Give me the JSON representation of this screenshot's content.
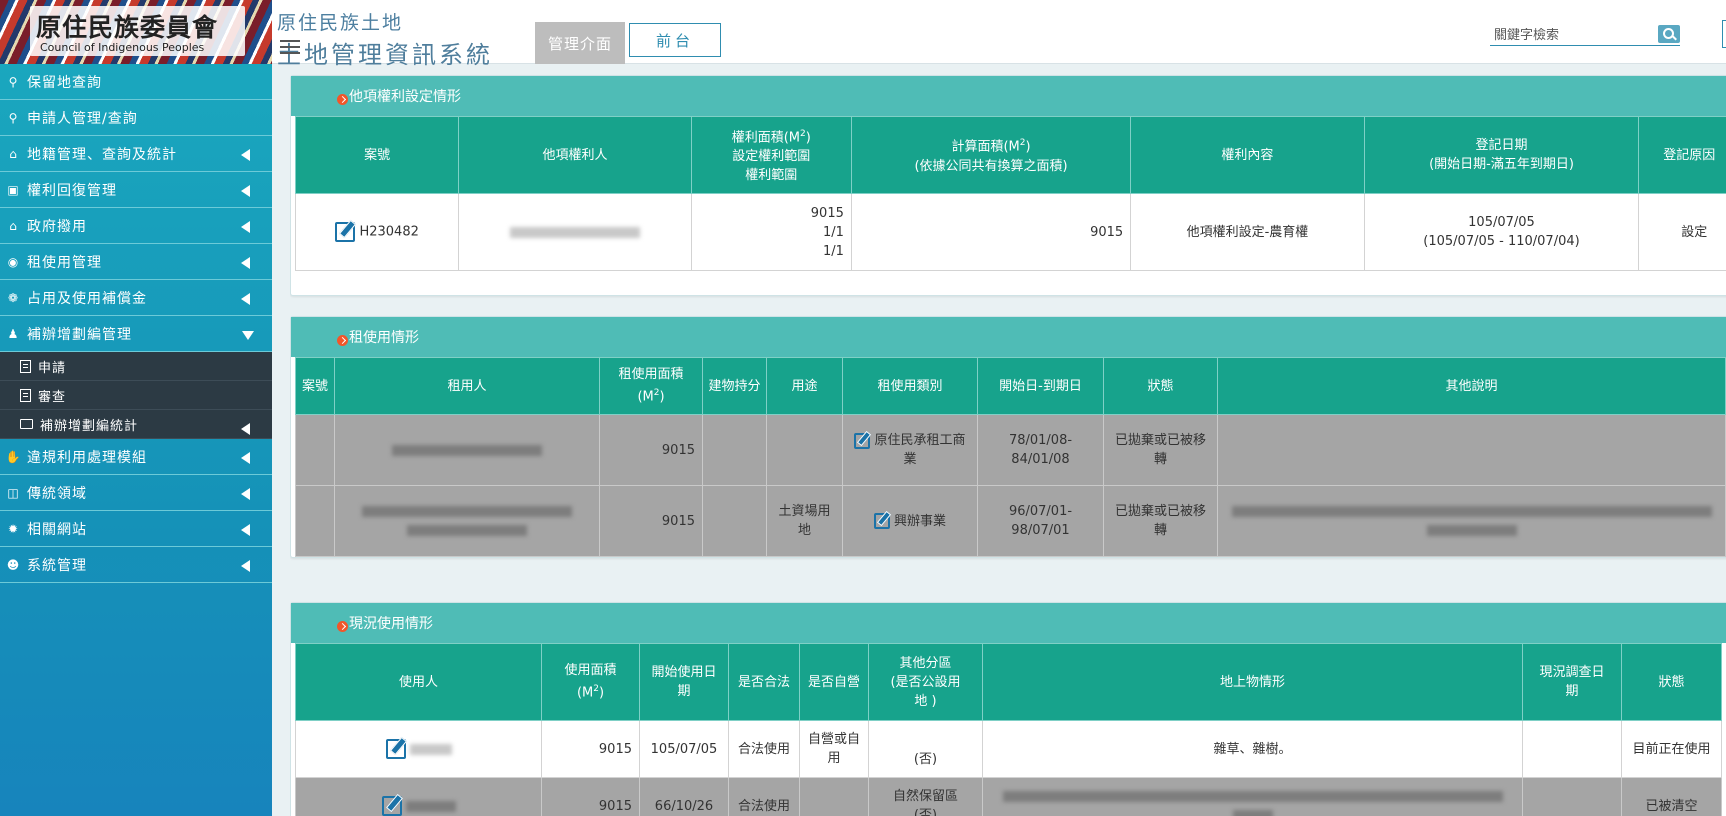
{
  "header": {
    "logo_zh": "原住民族委員會",
    "logo_en": "Council of Indigenous Peoples",
    "system_line1": "原住民族土地",
    "system_line2": "土地管理資訊系統",
    "tab_admin": "管理介面",
    "tab_front": "前台",
    "search_placeholder": "關鍵字檢索"
  },
  "sidebar": {
    "items": [
      {
        "label": "保留地查詢",
        "icon": "search-icon"
      },
      {
        "label": "申請人管理/查詢",
        "icon": "search-icon"
      },
      {
        "label": "地籍管理、查詢及統計",
        "icon": "home-icon"
      },
      {
        "label": "權利回復管理",
        "icon": "briefcase-icon"
      },
      {
        "label": "政府撥用",
        "icon": "home-icon"
      },
      {
        "label": "租使用管理",
        "icon": "cube-icon"
      },
      {
        "label": "占用及使用補償金",
        "icon": "paw-icon"
      },
      {
        "label": "補辦增劃編管理",
        "icon": "person-icon"
      }
    ],
    "sub_items": [
      {
        "label": "申請",
        "icon": "document-icon"
      },
      {
        "label": "審查",
        "icon": "document-icon"
      },
      {
        "label": "補辦增劃編統計",
        "icon": "folder-icon"
      }
    ],
    "items_after": [
      {
        "label": "違規利用處理模組",
        "icon": "hand-icon"
      },
      {
        "label": "傳統領域",
        "icon": "map-icon"
      },
      {
        "label": "相關網站",
        "icon": "gear-icon"
      },
      {
        "label": "系統管理",
        "icon": "user-circle-icon"
      }
    ]
  },
  "rights_panel": {
    "title": "他項權利設定情形",
    "headers": {
      "case_no": "案號",
      "holder": "他項權利人",
      "area_l1": "權利面積(M",
      "area_l2": "設定權利範圍",
      "area_l3": "權利範圍",
      "calc_l1": "計算面積(M",
      "calc_l2": "(依據公同共有換算之面積)",
      "content": "權利內容",
      "date_l1": "登記日期",
      "date_l2": "(開始日期-滿五年到期日)",
      "reason": "登記原因"
    },
    "row": {
      "case_no": "H230482",
      "area": "9015",
      "range1": "1/1",
      "range2": "1/1",
      "calc_area": "9015",
      "content": "他項權利設定-農育權",
      "date": "105/07/05",
      "date_range": "(105/07/05 - 110/07/04)",
      "reason": "設定"
    }
  },
  "lease_panel": {
    "title": "租使用情形",
    "headers": {
      "case_no": "案號",
      "tenant": "租用人",
      "area_l1": "租使用面積",
      "area_l2": "(M",
      "building_share": "建物持分",
      "purpose": "用途",
      "category": "租使用類別",
      "period": "開始日-到期日",
      "status": "狀態",
      "note": "其他說明"
    },
    "rows": [
      {
        "area": "9015",
        "purpose": "",
        "category": "原住民承租工商業",
        "start": "78/01/08-",
        "end": "84/01/08",
        "status": "已拋棄或已被移轉"
      },
      {
        "area": "9015",
        "purpose": "土資場用地",
        "category": "興辦事業",
        "start": "96/07/01-",
        "end": "98/07/01",
        "status": "已拋棄或已被移轉"
      }
    ]
  },
  "usage_panel": {
    "title": "現況使用情形",
    "headers": {
      "user": "使用人",
      "area_l1": "使用面積",
      "area_l2": "(M",
      "start_l1": "開始使用日",
      "start_l2": "期",
      "legal": "是否合法",
      "self_operated": "是否自營",
      "zone_l1": "其他分區",
      "zone_l2": "(是否公設用",
      "zone_l3": "地 )",
      "surface": "地上物情形",
      "survey_l1": "現況調查日",
      "survey_l2": "期",
      "status": "狀態"
    },
    "rows": [
      {
        "area": "9015",
        "start": "105/07/05",
        "legal": "合法使用",
        "self": "自營或自用",
        "zone": "(否)",
        "surface": "雜草、雜樹。",
        "status": "目前正在使用"
      },
      {
        "area": "9015",
        "start": "66/10/26",
        "legal": "合法使用",
        "self": "",
        "zone": "自然保留區",
        "zone2": "(否)",
        "status": "已被清空"
      }
    ]
  }
}
